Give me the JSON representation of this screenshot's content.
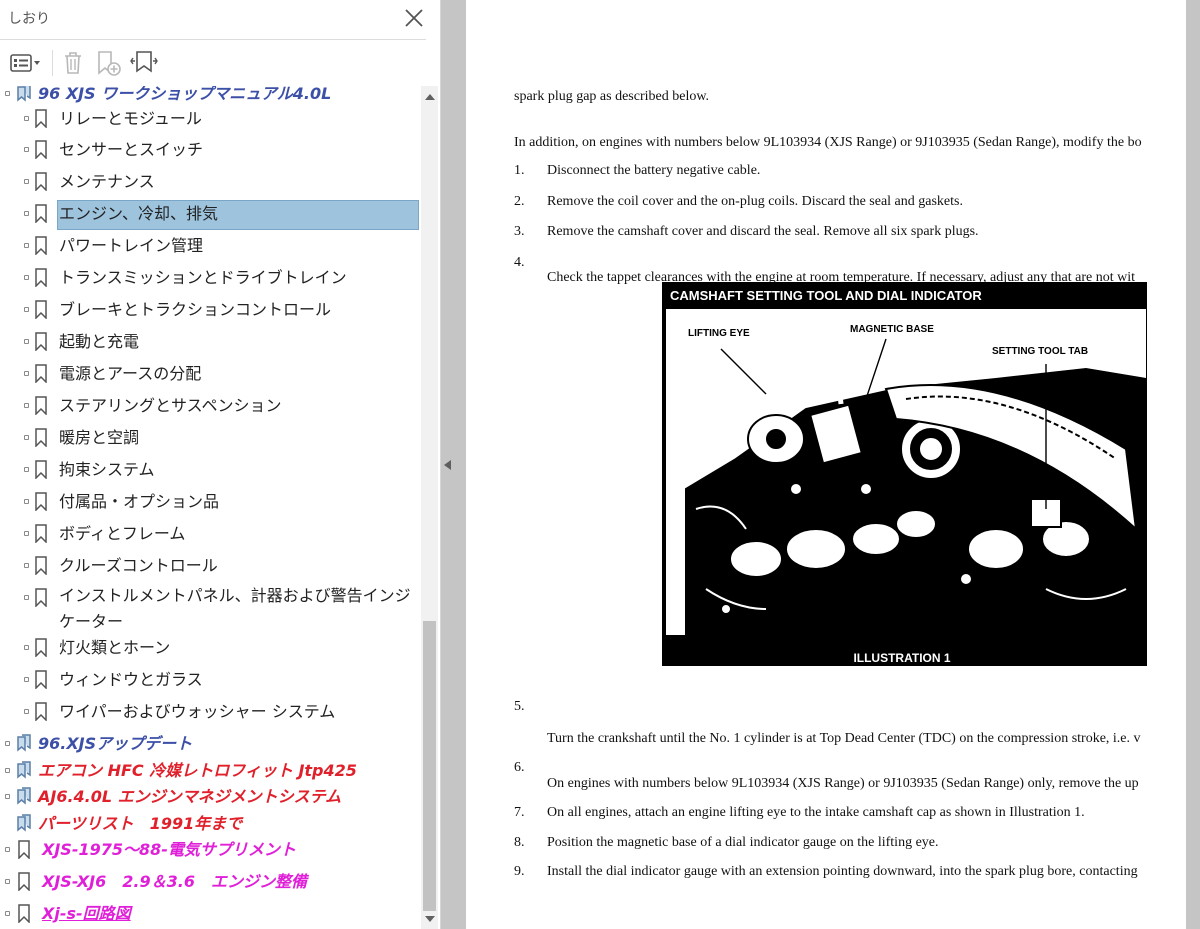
{
  "panel": {
    "title": "しおり",
    "toolbar": [
      "options",
      "delete",
      "new-bookmark",
      "find-bookmark"
    ],
    "items": [
      {
        "label": "96 XJS ワークショップマニュアル4.0L",
        "level": 0,
        "color": "#3c50a8"
      },
      {
        "label": "リレーとモジュール",
        "level": 1
      },
      {
        "label": "センサーとスイッチ",
        "level": 1
      },
      {
        "label": "メンテナンス",
        "level": 1
      },
      {
        "label": "エンジン、冷却、排気",
        "level": 1,
        "selected": true
      },
      {
        "label": "パワートレイン管理",
        "level": 1
      },
      {
        "label": "トランスミッションとドライブトレイン",
        "level": 1
      },
      {
        "label": "ブレーキとトラクションコントロール",
        "level": 1
      },
      {
        "label": "起動と充電",
        "level": 1
      },
      {
        "label": "電源とアースの分配",
        "level": 1
      },
      {
        "label": "ステアリングとサスペンション",
        "level": 1
      },
      {
        "label": "暖房と空調",
        "level": 1
      },
      {
        "label": "拘束システム",
        "level": 1
      },
      {
        "label": "付属品・オプション品",
        "level": 1
      },
      {
        "label": "ボディとフレーム",
        "level": 1
      },
      {
        "label": "クルーズコントロール",
        "level": 1
      },
      {
        "label": "インストルメントパネル、計器および警告インジケーター",
        "level": 1
      },
      {
        "label": "灯火類とホーン",
        "level": 1
      },
      {
        "label": "ウィンドウとガラス",
        "level": 1
      },
      {
        "label": "ワイパーおよびウォッシャー システム",
        "level": 1
      },
      {
        "label": "96.XJSアップデート",
        "level": 0,
        "color": "#3c50a8"
      },
      {
        "label": "エアコン HFC 冷媒レトロフィット Jtp425",
        "level": 0,
        "color": "#e0202a"
      },
      {
        "label": "AJ6.4.0L エンジンマネジメントシステム",
        "level": 0,
        "color": "#e0202a"
      },
      {
        "label": "パーツリスト　1991年まで",
        "level": 0,
        "color": "#e0202a"
      },
      {
        "label": "XJS-1975～88-電気サプリメント",
        "level": 0,
        "color": "#e020d8"
      },
      {
        "label": "XJS-XJ6　2.9＆3.6　エンジン整備",
        "level": 0,
        "color": "#e020d8"
      },
      {
        "label": "Xj-s-回路図",
        "level": 0,
        "color": "#e020d8"
      }
    ]
  },
  "document": {
    "intro": "spark plug gap as described below.",
    "addition": "In addition, on engines with numbers below 9L103934 (XJS Range) or 9J103935 (Sedan Range), modify the bo",
    "steps": [
      {
        "n": "1.",
        "text": "Disconnect the battery negative cable."
      },
      {
        "n": "2.",
        "text": "Remove the coil cover and the on-plug coils. Discard the seal and gaskets."
      },
      {
        "n": "3.",
        "text": "Remove the camshaft cover and discard the seal. Remove all six spark plugs."
      },
      {
        "n": "4.",
        "text": "Check the tappet clearances with the engine at room temperature. If necessary, adjust any that are not wit"
      },
      {
        "n": "5.",
        "text": "Turn the crankshaft until the No. 1 cylinder is at Top Dead Center (TDC) on the compression stroke, i.e. v"
      },
      {
        "n": "6.",
        "text": "On engines with numbers below 9L103934 (XJS Range) or 9J103935 (Sedan Range) only, remove the up"
      },
      {
        "n": "7.",
        "text": "On all engines, attach an engine lifting eye to the intake camshaft cap as shown in Illustration 1."
      },
      {
        "n": "8.",
        "text": "Position the magnetic base of a dial indicator gauge on the lifting eye."
      },
      {
        "n": "9.",
        "text": "Install the dial indicator gauge with an extension pointing downward, into the spark plug bore, contacting"
      }
    ],
    "illustration": {
      "title": "CAMSHAFT SETTING TOOL AND DIAL INDICATOR",
      "callouts": [
        "LIFTING EYE",
        "MAGNETIC BASE",
        "SETTING TOOL TAB"
      ],
      "caption": "ILLUSTRATION 1"
    }
  }
}
